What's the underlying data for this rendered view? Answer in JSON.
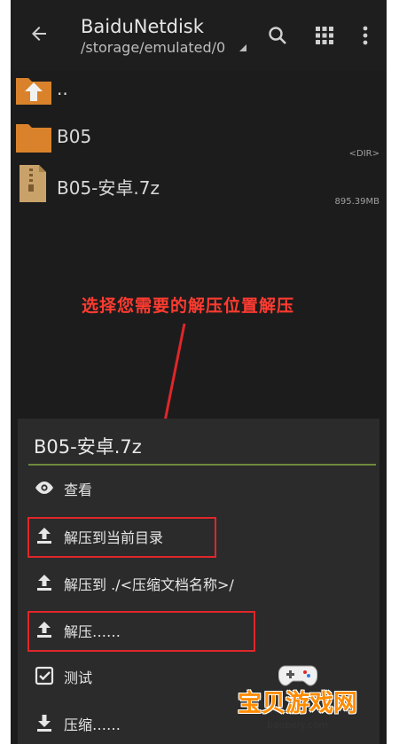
{
  "appbar": {
    "title": "BaiduNetdisk",
    "path": "/storage/emulated/0"
  },
  "files": [
    {
      "name": "..",
      "meta": "",
      "icon": "parent-folder-icon"
    },
    {
      "name": "B05",
      "meta": "<DIR>",
      "icon": "folder-icon"
    },
    {
      "name": "B05-安卓.7z",
      "meta": "895.39MB",
      "icon": "archive-file-icon"
    }
  ],
  "annotation": "选择您需要的解压位置解压",
  "sheet": {
    "title": "B05-安卓.7z",
    "items": [
      {
        "label": "查看",
        "icon": "eye-icon"
      },
      {
        "label": "解压到当前目录",
        "icon": "extract-icon"
      },
      {
        "label": "解压到 ./<压缩文档名称>/",
        "icon": "extract-icon"
      },
      {
        "label": "解压……",
        "icon": "extract-icon"
      },
      {
        "label": "测试",
        "icon": "checkbox-icon"
      },
      {
        "label": "压缩……",
        "icon": "compress-icon"
      }
    ]
  },
  "watermark": {
    "text": "宝贝游戏网",
    "url": "baobeiy.com"
  },
  "colors": {
    "background": "#1c1c1c",
    "accent_divider": "#6e8a3a",
    "annotation": "#ff3b30",
    "highlight_box": "#e0262a"
  }
}
